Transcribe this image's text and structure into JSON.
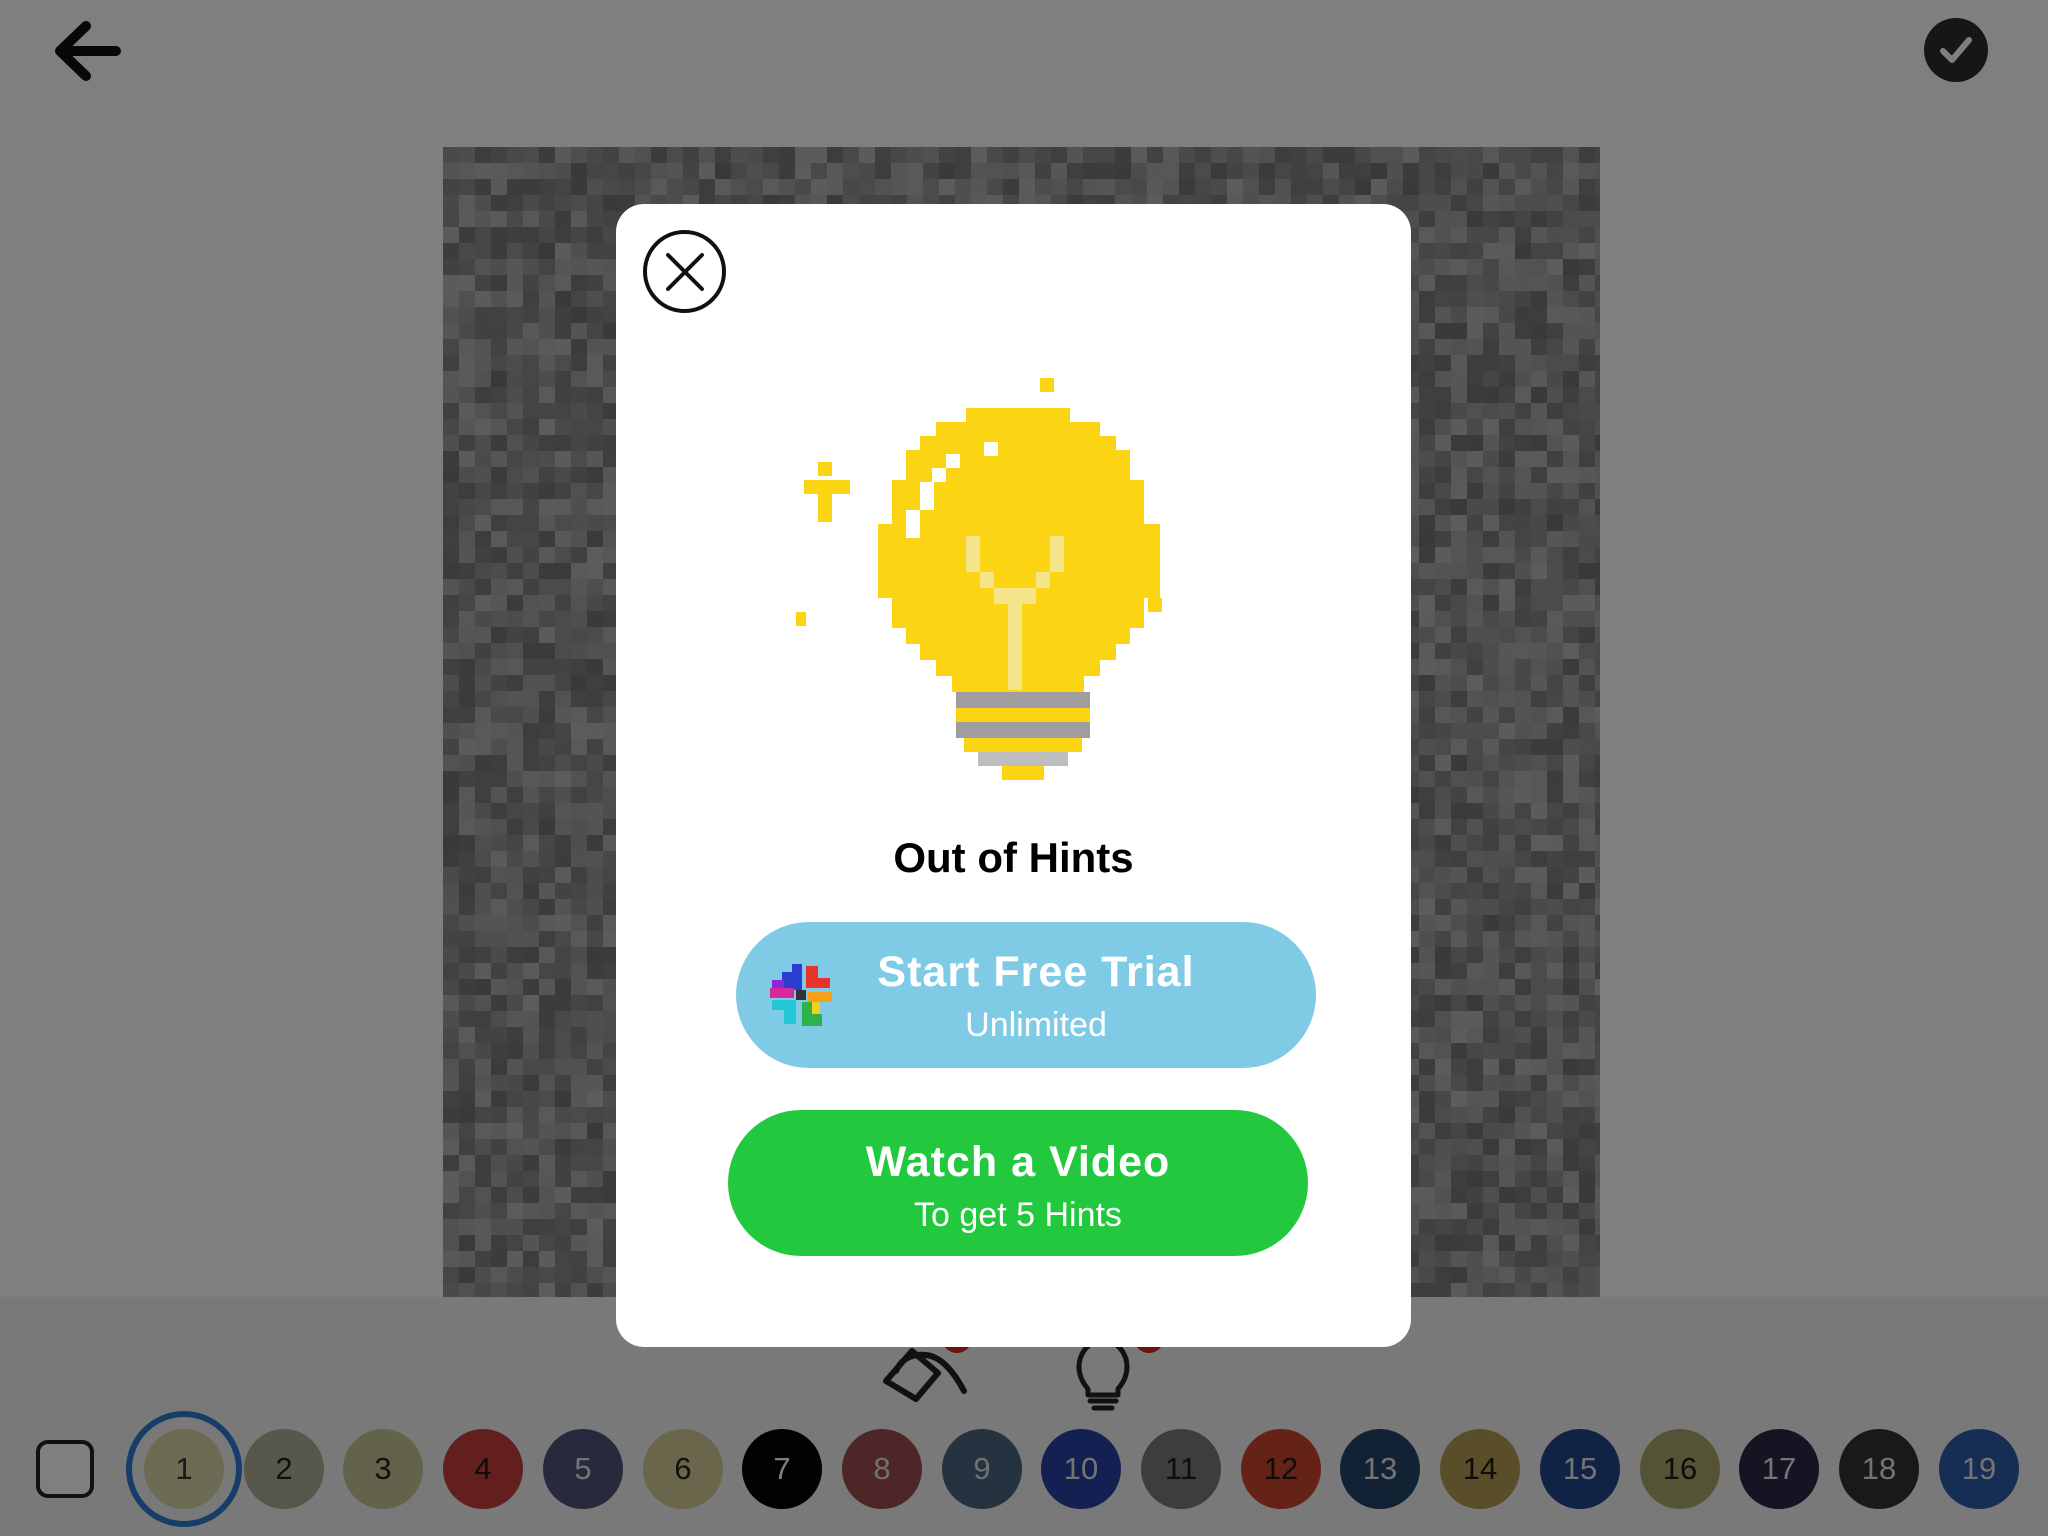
{
  "game": {
    "palette": [
      {
        "label": "1",
        "color": "#dcd7a8",
        "text": "#333333",
        "selected": true
      },
      {
        "label": "2",
        "color": "#aeae96",
        "text": "#222222"
      },
      {
        "label": "3",
        "color": "#c7c494",
        "text": "#222222"
      },
      {
        "label": "4",
        "color": "#c63c3c",
        "text": "#1a1a1a"
      },
      {
        "label": "5",
        "color": "#4d5478",
        "text": "#e8e8e8"
      },
      {
        "label": "6",
        "color": "#d2cd96",
        "text": "#222222"
      },
      {
        "label": "7",
        "color": "#050505",
        "text": "#ffffff"
      },
      {
        "label": "8",
        "color": "#9a4e50",
        "text": "#e0e0e0"
      },
      {
        "label": "9",
        "color": "#4a6682",
        "text": "#e0e0e0"
      },
      {
        "label": "10",
        "color": "#2840a2",
        "text": "#e8e8e8"
      },
      {
        "label": "11",
        "color": "#7a7a7a",
        "text": "#1a1a1a"
      },
      {
        "label": "12",
        "color": "#c9462c",
        "text": "#1a1a1a"
      },
      {
        "label": "13",
        "color": "#25446a",
        "text": "#e8e8e8"
      },
      {
        "label": "14",
        "color": "#b49a52",
        "text": "#1a1a1a"
      },
      {
        "label": "15",
        "color": "#21468f",
        "text": "#e8e8e8"
      },
      {
        "label": "16",
        "color": "#a9a66c",
        "text": "#1a1a1a"
      },
      {
        "label": "17",
        "color": "#282845",
        "text": "#e8e8e8"
      },
      {
        "label": "18",
        "color": "#333333",
        "text": "#e8e8e8"
      },
      {
        "label": "19",
        "color": "#2c5aa8",
        "text": "#e8e8e8"
      }
    ]
  },
  "modal": {
    "title": "Out of Hints",
    "trial_button": {
      "title": "Start Free Trial",
      "subtitle": "Unlimited"
    },
    "video_button": {
      "title": "Watch a Video",
      "subtitle": "To get 5 Hints"
    }
  },
  "icons": {
    "back": "arrow-left-icon",
    "done": "checkmark-icon",
    "close": "close-icon",
    "bulb": "lightbulb-illustration",
    "bucket": "paint-bucket-icon",
    "hint": "lightbulb-icon",
    "trial_logo": "pinwheel-logo"
  },
  "colors": {
    "trial_button": "#7fcbe6",
    "video_button": "#22c93f",
    "bulb_yellow": "#fbd414",
    "overlay": "rgba(0,0,0,0.5)"
  }
}
